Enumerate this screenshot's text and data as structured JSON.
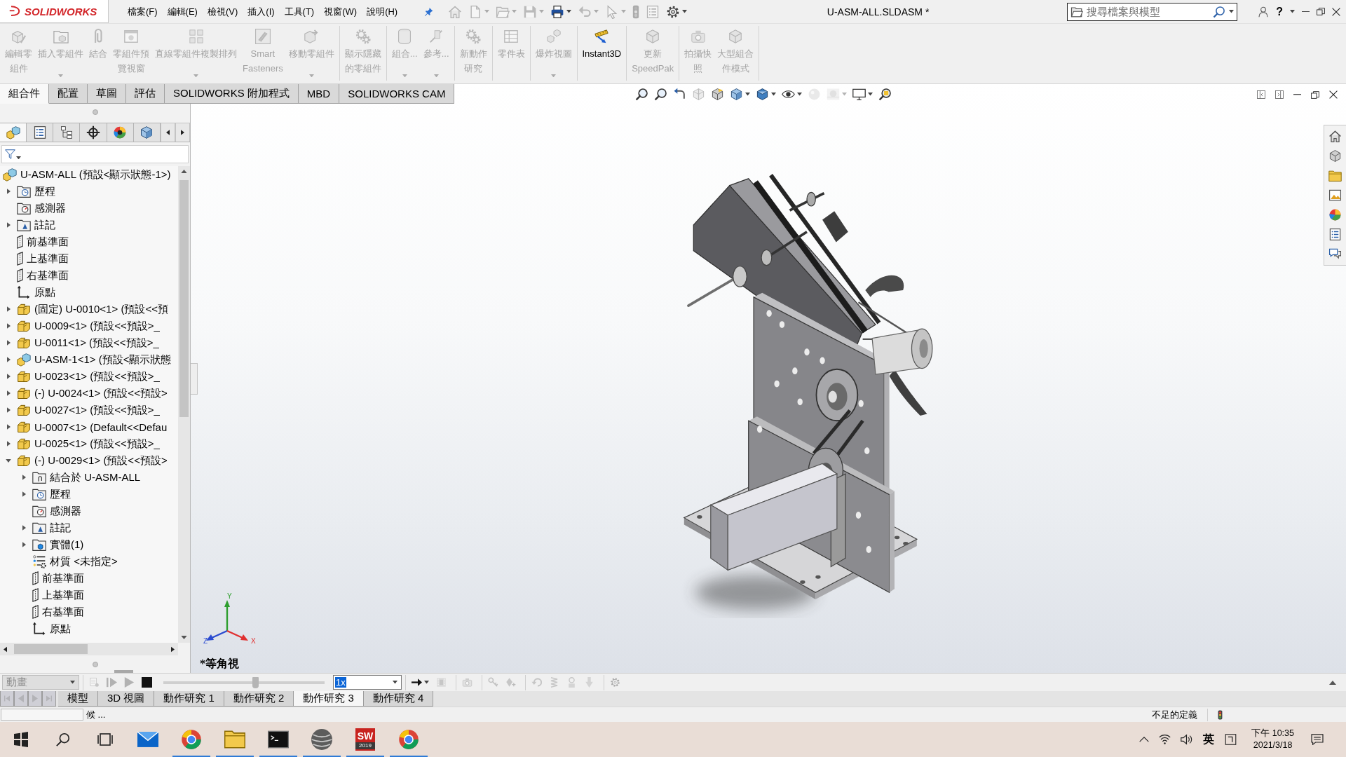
{
  "menu_bar": {
    "logo": "SOLIDWORKS",
    "menus": [
      "檔案(F)",
      "編輯(E)",
      "檢視(V)",
      "插入(I)",
      "工具(T)",
      "視窗(W)",
      "說明(H)"
    ]
  },
  "quick_access": [
    {
      "kind": "home",
      "disabled": true,
      "dropdown": false
    },
    {
      "kind": "new",
      "disabled": true,
      "dropdown": true
    },
    {
      "kind": "open",
      "disabled": true,
      "dropdown": true
    },
    {
      "kind": "save",
      "disabled": true,
      "dropdown": true
    },
    {
      "kind": "print",
      "disabled": false,
      "dropdown": true
    },
    {
      "kind": "undo",
      "disabled": true,
      "dropdown": true
    },
    {
      "kind": "select",
      "disabled": true,
      "dropdown": true
    },
    {
      "kind": "rebuild",
      "disabled": true,
      "dropdown": false
    },
    {
      "kind": "file-properties",
      "disabled": true,
      "dropdown": false
    },
    {
      "kind": "options",
      "disabled": false,
      "dropdown": true
    }
  ],
  "window": {
    "title": "U-ASM-ALL.SLDASM *",
    "help_button": "?"
  },
  "search": {
    "placeholder": "搜尋檔案與模型"
  },
  "command_manager": {
    "groups": [
      {
        "buttons": [
          {
            "kind": "edit-component",
            "lines": [
              "編輯零",
              "組件"
            ],
            "disabled": true,
            "dropdown": false
          },
          {
            "kind": "insert-components",
            "lines": [
              "插入零組件"
            ],
            "disabled": true,
            "dropdown": true
          },
          {
            "kind": "mate",
            "lines": [
              "結合"
            ],
            "disabled": true,
            "dropdown": false
          },
          {
            "kind": "component-preview",
            "lines": [
              "零組件預",
              "覽視窗"
            ],
            "disabled": true,
            "dropdown": false
          },
          {
            "kind": "linear-pattern",
            "lines": [
              "直線零組件複製排列"
            ],
            "disabled": true,
            "dropdown": true
          },
          {
            "kind": "smart-fasteners",
            "lines": [
              "Smart",
              "Fasteners"
            ],
            "disabled": true,
            "dropdown": false
          },
          {
            "kind": "move-component",
            "lines": [
              "移動零組件"
            ],
            "disabled": true,
            "dropdown": true
          }
        ]
      },
      {
        "buttons": [
          {
            "kind": "show-hidden",
            "lines": [
              "顯示隱藏",
              "的零組件"
            ],
            "disabled": true,
            "dropdown": false
          }
        ]
      },
      {
        "buttons": [
          {
            "kind": "assembly-features",
            "lines": [
              "組合..."
            ],
            "disabled": true,
            "dropdown": true
          },
          {
            "kind": "reference-geometry",
            "lines": [
              "參考..."
            ],
            "disabled": true,
            "dropdown": true
          }
        ]
      },
      {
        "buttons": [
          {
            "kind": "new-motion-study",
            "lines": [
              "新動作",
              "研究"
            ],
            "disabled": true,
            "dropdown": false
          }
        ]
      },
      {
        "buttons": [
          {
            "kind": "bill-of-materials",
            "lines": [
              "零件表"
            ],
            "disabled": true,
            "dropdown": false
          }
        ]
      },
      {
        "buttons": [
          {
            "kind": "exploded-view",
            "lines": [
              "爆炸視圖"
            ],
            "disabled": true,
            "dropdown": true
          }
        ]
      },
      {
        "buttons": [
          {
            "kind": "instant3d",
            "lines": [
              "Instant3D"
            ],
            "disabled": false,
            "dropdown": false
          }
        ]
      },
      {
        "buttons": [
          {
            "kind": "speedpak",
            "lines": [
              "更新",
              "SpeedPak"
            ],
            "disabled": true,
            "dropdown": false
          }
        ]
      },
      {
        "buttons": [
          {
            "kind": "snapshot",
            "lines": [
              "拍攝快",
              "照"
            ],
            "disabled": true,
            "dropdown": false
          },
          {
            "kind": "large-assembly",
            "lines": [
              "大型組合",
              "件模式"
            ],
            "disabled": true,
            "dropdown": false
          }
        ]
      }
    ],
    "tabs": [
      {
        "label": "組合件",
        "selected": true
      },
      {
        "label": "配置",
        "selected": false
      },
      {
        "label": "草圖",
        "selected": false
      },
      {
        "label": "評估",
        "selected": false
      },
      {
        "label": "SOLIDWORKS 附加程式",
        "selected": false
      },
      {
        "label": "MBD",
        "selected": false
      },
      {
        "label": "SOLIDWORKS CAM",
        "selected": false
      }
    ]
  },
  "feature_manager": {
    "tabs": [
      {
        "kind": "feature-tree",
        "selected": true
      },
      {
        "kind": "properties",
        "selected": false
      },
      {
        "kind": "configurations",
        "selected": false
      },
      {
        "kind": "dimxpert",
        "selected": false
      },
      {
        "kind": "display",
        "selected": false
      },
      {
        "kind": "cam",
        "selected": false
      }
    ],
    "tree": [
      {
        "kind": "assembly",
        "label": "U-ASM-ALL (預設<顯示狀態-1>)",
        "children": [
          {
            "kind": "history",
            "label": "歷程",
            "expanded": false
          },
          {
            "kind": "sensors",
            "label": "感測器"
          },
          {
            "kind": "annotations",
            "label": "註記",
            "expanded": false
          },
          {
            "kind": "plane",
            "label": "前基準面"
          },
          {
            "kind": "plane",
            "label": "上基準面"
          },
          {
            "kind": "plane",
            "label": "右基準面"
          },
          {
            "kind": "origin",
            "label": "原點"
          },
          {
            "kind": "part",
            "label": "(固定) U-0010<1> (預設<<預",
            "expanded": false
          },
          {
            "kind": "part",
            "label": "U-0009<1> (預設<<預設>_",
            "expanded": false
          },
          {
            "kind": "part",
            "label": "U-0011<1> (預設<<預設>_",
            "expanded": false
          },
          {
            "kind": "subassembly",
            "label": "U-ASM-1<1> (預設<顯示狀態",
            "expanded": false
          },
          {
            "kind": "part",
            "label": "U-0023<1> (預設<<預設>_",
            "expanded": false
          },
          {
            "kind": "part",
            "label": "(-) U-0024<1> (預設<<預設>",
            "expanded": false
          },
          {
            "kind": "part",
            "label": "U-0027<1> (預設<<預設>_",
            "expanded": false
          },
          {
            "kind": "part",
            "label": "U-0007<1> (Default<<Defau",
            "expanded": false
          },
          {
            "kind": "part",
            "label": "U-0025<1> (預設<<預設>_",
            "expanded": false
          },
          {
            "kind": "part",
            "label": "(-) U-0029<1> (預設<<預設>",
            "expanded": true,
            "children": [
              {
                "kind": "mates",
                "label": "結合於 U-ASM-ALL",
                "expanded": false
              },
              {
                "kind": "history",
                "label": "歷程",
                "expanded": false
              },
              {
                "kind": "sensors",
                "label": "感測器"
              },
              {
                "kind": "annotations",
                "label": "註記",
                "expanded": false
              },
              {
                "kind": "solid-bodies",
                "label": "實體(1)",
                "expanded": false
              },
              {
                "kind": "material",
                "label": "材質 <未指定>"
              },
              {
                "kind": "plane",
                "label": "前基準面"
              },
              {
                "kind": "plane",
                "label": "上基準面"
              },
              {
                "kind": "plane",
                "label": "右基準面"
              },
              {
                "kind": "origin",
                "label": "原點"
              }
            ]
          }
        ]
      }
    ]
  },
  "viewport": {
    "view_tools": [
      {
        "kind": "zoom-fit",
        "disabled": false,
        "dropdown": false
      },
      {
        "kind": "zoom-area",
        "disabled": false,
        "dropdown": false
      },
      {
        "kind": "previous-view",
        "disabled": false,
        "dropdown": false
      },
      {
        "kind": "section-view",
        "disabled": true,
        "dropdown": false
      },
      {
        "kind": "annotation-views",
        "disabled": false,
        "dropdown": false
      },
      {
        "kind": "view-orientation",
        "disabled": false,
        "dropdown": true
      },
      {
        "kind": "display-style",
        "disabled": false,
        "dropdown": true
      },
      {
        "kind": "hide-show",
        "disabled": false,
        "dropdown": true
      },
      {
        "kind": "edit-appearance",
        "disabled": true,
        "dropdown": false
      },
      {
        "kind": "apply-scene",
        "disabled": true,
        "dropdown": true
      },
      {
        "kind": "view-settings",
        "disabled": false,
        "dropdown": true
      },
      {
        "kind": "zoom-selection",
        "disabled": false,
        "dropdown": false
      }
    ],
    "task_pane": [
      {
        "kind": "home"
      },
      {
        "kind": "content"
      },
      {
        "kind": "explorer"
      },
      {
        "kind": "palette"
      },
      {
        "kind": "appearances"
      },
      {
        "kind": "properties"
      },
      {
        "kind": "forum"
      }
    ],
    "axes": [
      {
        "kind": "y",
        "label": "Y"
      },
      {
        "kind": "z",
        "label": "Z"
      },
      {
        "kind": "x",
        "label": "X"
      }
    ],
    "view_name": "*等角視"
  },
  "motion_manager": {
    "study_type": {
      "value": "動畫",
      "disabled": true
    },
    "tools": [
      {
        "kind": "calculate",
        "disabled": true
      },
      {
        "kind": "play-from-start",
        "disabled": true
      },
      {
        "kind": "play",
        "disabled": true
      },
      {
        "kind": "stop",
        "disabled": false
      }
    ],
    "speed_slider": {
      "level": 0.57
    },
    "playback_speed": {
      "value": "1x",
      "text_selected": true
    },
    "tool_groups": [
      {
        "tools": [
          {
            "kind": "playback-mode",
            "disabled": false,
            "dropdown": true
          },
          {
            "kind": "save-animation",
            "disabled": true,
            "dropdown": false
          }
        ]
      },
      {
        "tools": [
          {
            "kind": "animation-wizard",
            "disabled": true,
            "dropdown": false
          }
        ]
      },
      {
        "tools": [
          {
            "kind": "autokey",
            "disabled": true,
            "dropdown": false
          },
          {
            "kind": "add-key",
            "disabled": true,
            "dropdown": false
          }
        ]
      },
      {
        "tools": [
          {
            "kind": "motor",
            "disabled": true,
            "dropdown": false
          },
          {
            "kind": "spring",
            "disabled": true,
            "dropdown": false
          },
          {
            "kind": "contact",
            "disabled": true,
            "dropdown": false
          },
          {
            "kind": "gravity",
            "disabled": true,
            "dropdown": false
          }
        ]
      },
      {
        "tools": [
          {
            "kind": "motion-properties",
            "disabled": true,
            "dropdown": false
          }
        ]
      }
    ],
    "tab_scroll": [
      {
        "kind": "first",
        "disabled": true
      },
      {
        "kind": "previous",
        "disabled": true
      },
      {
        "kind": "next",
        "disabled": true
      },
      {
        "kind": "last",
        "disabled": true
      }
    ],
    "tabs": [
      {
        "label": "模型",
        "selected": false
      },
      {
        "label": "3D 視圖",
        "selected": false
      },
      {
        "label": "動作研究 1",
        "selected": false
      },
      {
        "label": "動作研究 2",
        "selected": false
      },
      {
        "label": "動作研究 3",
        "selected": true
      },
      {
        "label": "動作研究 4",
        "selected": false
      }
    ]
  },
  "status_bar": {
    "message": "候 ...",
    "definition": "不足的定義"
  },
  "taskbar": {
    "apps": [
      {
        "kind": "mail",
        "running": false
      },
      {
        "kind": "browser",
        "running": true
      },
      {
        "kind": "file-explorer",
        "running": true
      },
      {
        "kind": "terminal",
        "running": true
      },
      {
        "kind": "sphere-app",
        "running": true
      },
      {
        "kind": "cad-app",
        "running": true,
        "badge": "SW",
        "version": "2019"
      },
      {
        "kind": "color-ring-app",
        "running": true
      }
    ],
    "ime": "英",
    "time": "下午 10:35",
    "date": "2021/3/18"
  }
}
